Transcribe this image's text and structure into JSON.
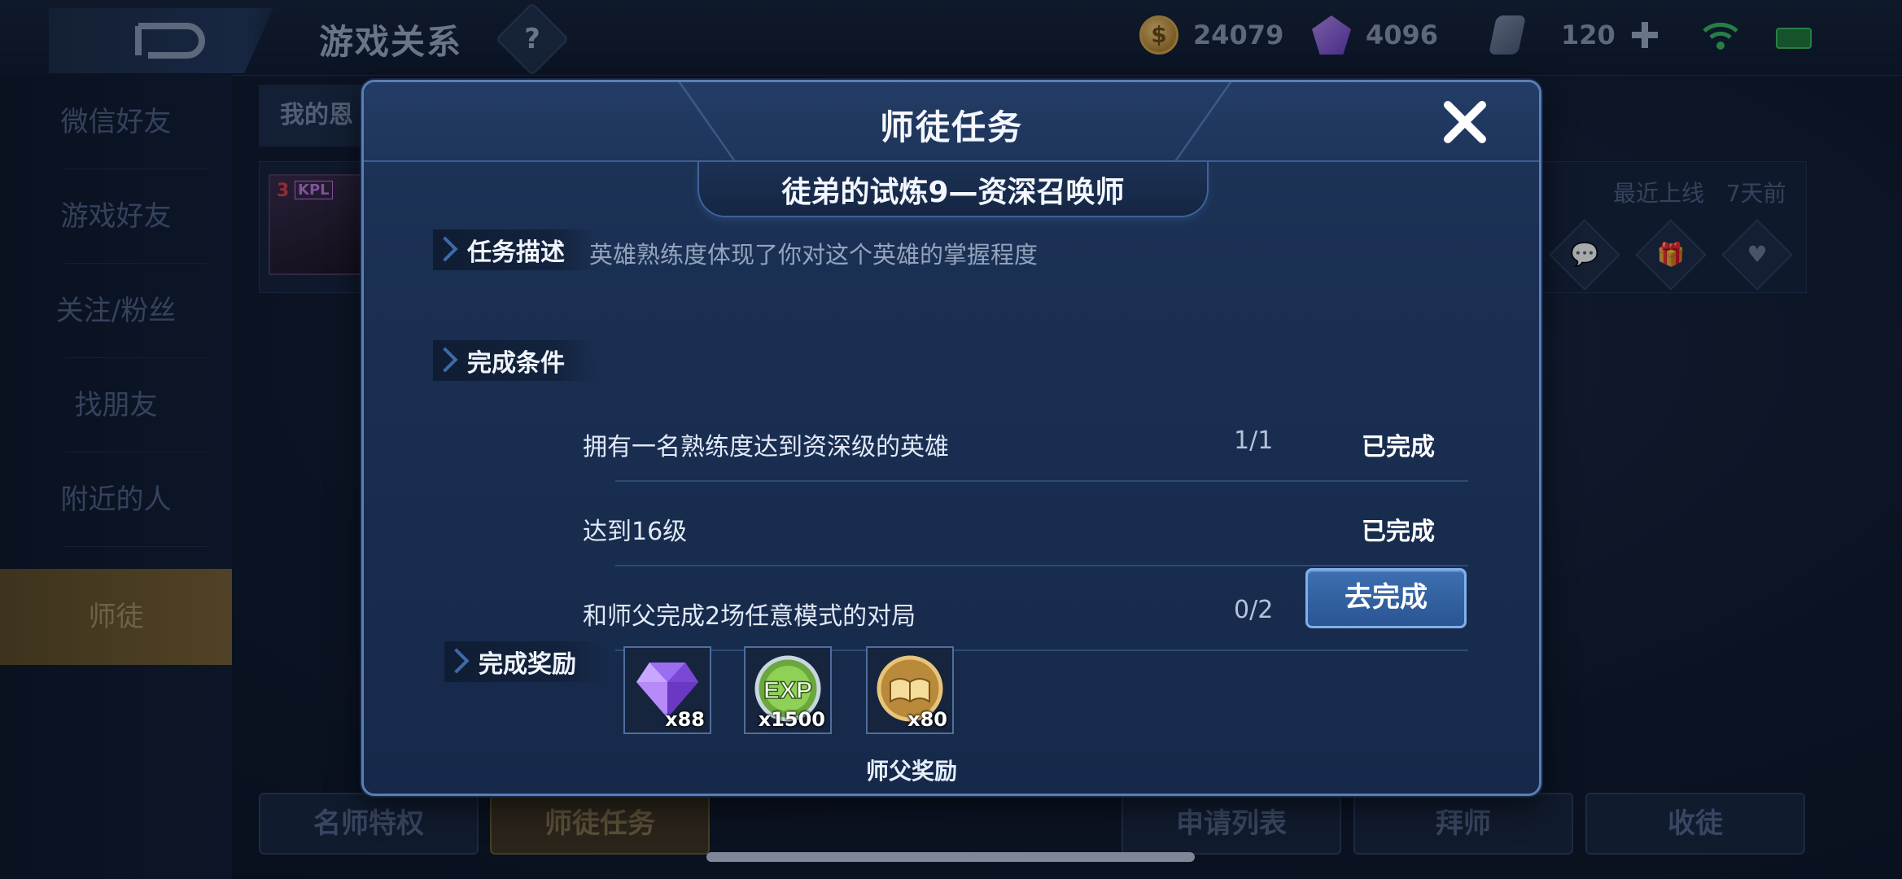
{
  "topbar": {
    "title": "游戏关系",
    "help": "?",
    "currencies": [
      {
        "icon": "gold-coin-icon",
        "value": "24079"
      },
      {
        "icon": "purple-gem-icon",
        "value": "4096"
      },
      {
        "icon": "ticket-icon",
        "value": "120"
      }
    ]
  },
  "sidebar": {
    "items": [
      {
        "label": "微信好友"
      },
      {
        "label": "游戏好友"
      },
      {
        "label": "关注/粉丝"
      },
      {
        "label": "找朋友"
      },
      {
        "label": "附近的人"
      },
      {
        "label": "师徒"
      }
    ]
  },
  "background": {
    "tab": "我的恩",
    "card": {
      "level": "3",
      "badge": "KPL",
      "online_label": "最近上线",
      "online_time": "7天前"
    },
    "bottom_buttons": [
      {
        "label": "名师特权"
      },
      {
        "label": "师徒任务"
      },
      {
        "label": "申请列表"
      },
      {
        "label": "拜师"
      },
      {
        "label": "收徒"
      }
    ]
  },
  "modal": {
    "title": "师徒任务",
    "subtitle": "徒弟的试炼9—资深召唤师",
    "description_label": "任务描述",
    "description": "英雄熟练度体现了你对这个英雄的掌握程度",
    "conditions_label": "完成条件",
    "conditions": [
      {
        "text": "拥有一名熟练度达到资深级的英雄",
        "progress": "1/1",
        "status": "已完成"
      },
      {
        "text": "达到16级",
        "progress": "",
        "status": "已完成"
      },
      {
        "text": "和师父完成2场任意模式的对局",
        "progress": "0/2",
        "status": ""
      }
    ],
    "go_button": "去完成",
    "rewards_label": "完成奖励",
    "rewards": [
      {
        "icon": "diamond-icon",
        "qty": "x88"
      },
      {
        "icon": "exp-icon",
        "qty": "x1500",
        "art_text": "EXP"
      },
      {
        "icon": "book-medal-icon",
        "qty": "x80"
      }
    ],
    "reward_caption": "师父奖励"
  },
  "colors": {
    "accent_blue": "#3d6fb0",
    "modal_border": "#5b7fb4",
    "sidebar_active": "#7a6230"
  }
}
